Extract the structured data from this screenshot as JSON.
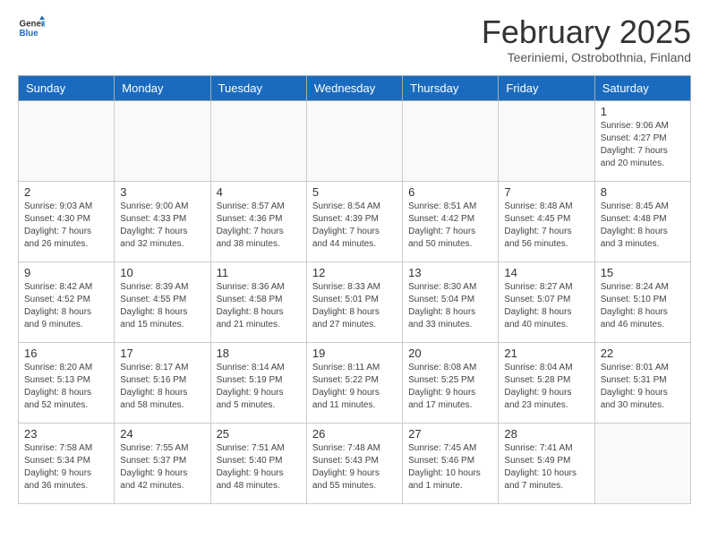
{
  "header": {
    "logo_general": "General",
    "logo_blue": "Blue",
    "month_title": "February 2025",
    "location": "Teeriniemi, Ostrobothnia, Finland"
  },
  "days_of_week": [
    "Sunday",
    "Monday",
    "Tuesday",
    "Wednesday",
    "Thursday",
    "Friday",
    "Saturday"
  ],
  "weeks": [
    [
      {
        "day": "",
        "info": ""
      },
      {
        "day": "",
        "info": ""
      },
      {
        "day": "",
        "info": ""
      },
      {
        "day": "",
        "info": ""
      },
      {
        "day": "",
        "info": ""
      },
      {
        "day": "",
        "info": ""
      },
      {
        "day": "1",
        "info": "Sunrise: 9:06 AM\nSunset: 4:27 PM\nDaylight: 7 hours\nand 20 minutes."
      }
    ],
    [
      {
        "day": "2",
        "info": "Sunrise: 9:03 AM\nSunset: 4:30 PM\nDaylight: 7 hours\nand 26 minutes."
      },
      {
        "day": "3",
        "info": "Sunrise: 9:00 AM\nSunset: 4:33 PM\nDaylight: 7 hours\nand 32 minutes."
      },
      {
        "day": "4",
        "info": "Sunrise: 8:57 AM\nSunset: 4:36 PM\nDaylight: 7 hours\nand 38 minutes."
      },
      {
        "day": "5",
        "info": "Sunrise: 8:54 AM\nSunset: 4:39 PM\nDaylight: 7 hours\nand 44 minutes."
      },
      {
        "day": "6",
        "info": "Sunrise: 8:51 AM\nSunset: 4:42 PM\nDaylight: 7 hours\nand 50 minutes."
      },
      {
        "day": "7",
        "info": "Sunrise: 8:48 AM\nSunset: 4:45 PM\nDaylight: 7 hours\nand 56 minutes."
      },
      {
        "day": "8",
        "info": "Sunrise: 8:45 AM\nSunset: 4:48 PM\nDaylight: 8 hours\nand 3 minutes."
      }
    ],
    [
      {
        "day": "9",
        "info": "Sunrise: 8:42 AM\nSunset: 4:52 PM\nDaylight: 8 hours\nand 9 minutes."
      },
      {
        "day": "10",
        "info": "Sunrise: 8:39 AM\nSunset: 4:55 PM\nDaylight: 8 hours\nand 15 minutes."
      },
      {
        "day": "11",
        "info": "Sunrise: 8:36 AM\nSunset: 4:58 PM\nDaylight: 8 hours\nand 21 minutes."
      },
      {
        "day": "12",
        "info": "Sunrise: 8:33 AM\nSunset: 5:01 PM\nDaylight: 8 hours\nand 27 minutes."
      },
      {
        "day": "13",
        "info": "Sunrise: 8:30 AM\nSunset: 5:04 PM\nDaylight: 8 hours\nand 33 minutes."
      },
      {
        "day": "14",
        "info": "Sunrise: 8:27 AM\nSunset: 5:07 PM\nDaylight: 8 hours\nand 40 minutes."
      },
      {
        "day": "15",
        "info": "Sunrise: 8:24 AM\nSunset: 5:10 PM\nDaylight: 8 hours\nand 46 minutes."
      }
    ],
    [
      {
        "day": "16",
        "info": "Sunrise: 8:20 AM\nSunset: 5:13 PM\nDaylight: 8 hours\nand 52 minutes."
      },
      {
        "day": "17",
        "info": "Sunrise: 8:17 AM\nSunset: 5:16 PM\nDaylight: 8 hours\nand 58 minutes."
      },
      {
        "day": "18",
        "info": "Sunrise: 8:14 AM\nSunset: 5:19 PM\nDaylight: 9 hours\nand 5 minutes."
      },
      {
        "day": "19",
        "info": "Sunrise: 8:11 AM\nSunset: 5:22 PM\nDaylight: 9 hours\nand 11 minutes."
      },
      {
        "day": "20",
        "info": "Sunrise: 8:08 AM\nSunset: 5:25 PM\nDaylight: 9 hours\nand 17 minutes."
      },
      {
        "day": "21",
        "info": "Sunrise: 8:04 AM\nSunset: 5:28 PM\nDaylight: 9 hours\nand 23 minutes."
      },
      {
        "day": "22",
        "info": "Sunrise: 8:01 AM\nSunset: 5:31 PM\nDaylight: 9 hours\nand 30 minutes."
      }
    ],
    [
      {
        "day": "23",
        "info": "Sunrise: 7:58 AM\nSunset: 5:34 PM\nDaylight: 9 hours\nand 36 minutes."
      },
      {
        "day": "24",
        "info": "Sunrise: 7:55 AM\nSunset: 5:37 PM\nDaylight: 9 hours\nand 42 minutes."
      },
      {
        "day": "25",
        "info": "Sunrise: 7:51 AM\nSunset: 5:40 PM\nDaylight: 9 hours\nand 48 minutes."
      },
      {
        "day": "26",
        "info": "Sunrise: 7:48 AM\nSunset: 5:43 PM\nDaylight: 9 hours\nand 55 minutes."
      },
      {
        "day": "27",
        "info": "Sunrise: 7:45 AM\nSunset: 5:46 PM\nDaylight: 10 hours\nand 1 minute."
      },
      {
        "day": "28",
        "info": "Sunrise: 7:41 AM\nSunset: 5:49 PM\nDaylight: 10 hours\nand 7 minutes."
      },
      {
        "day": "",
        "info": ""
      }
    ]
  ]
}
